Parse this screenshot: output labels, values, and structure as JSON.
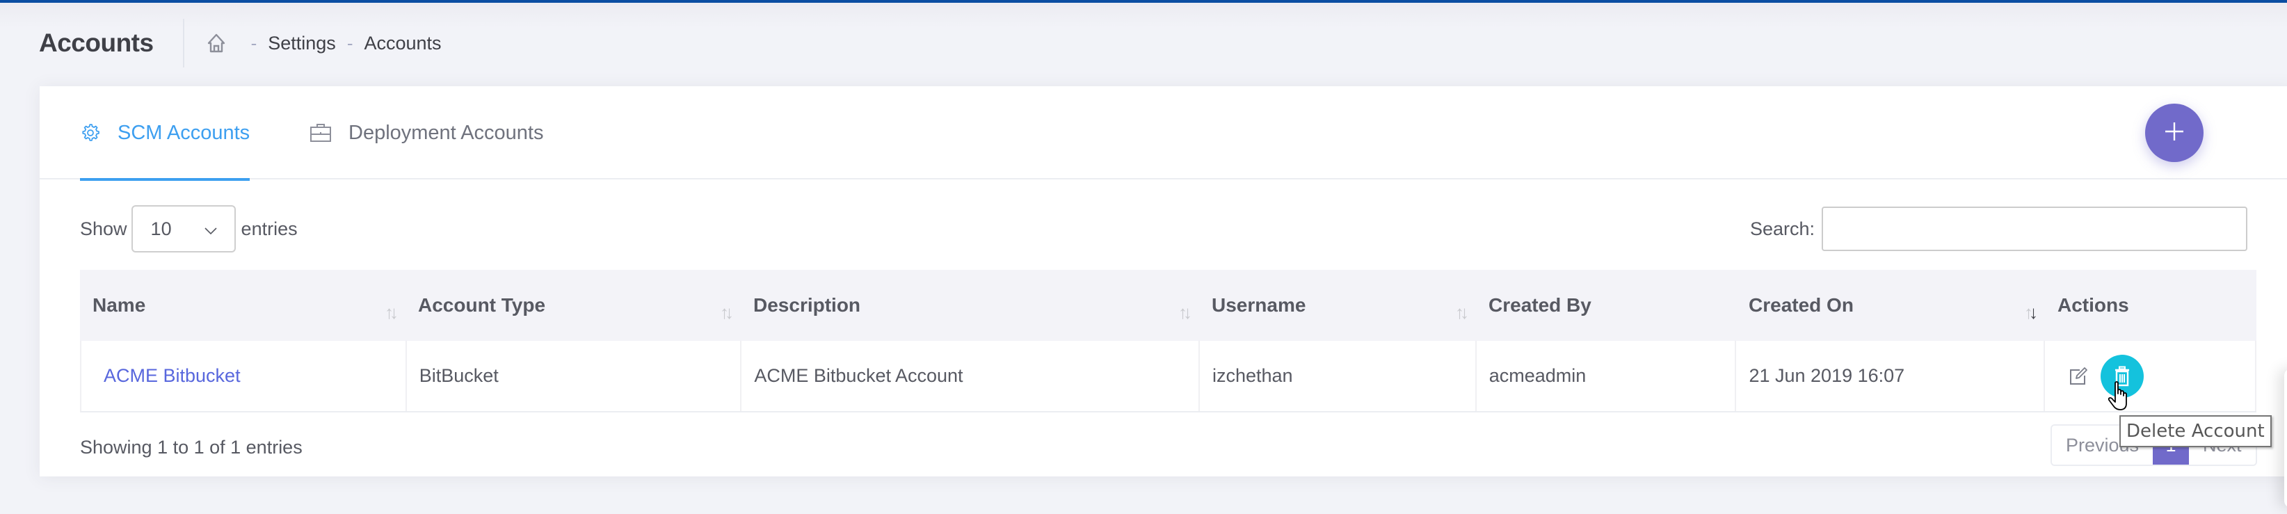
{
  "header": {
    "title": "Accounts",
    "breadcrumb": [
      {
        "label": "home",
        "icon": "home-icon"
      },
      {
        "label": "Settings"
      },
      {
        "label": "Accounts"
      }
    ],
    "separator": "-"
  },
  "tabs": [
    {
      "label": "SCM Accounts",
      "icon": "gear-icon",
      "active": true
    },
    {
      "label": "Deployment Accounts",
      "icon": "briefcase-icon",
      "active": false
    }
  ],
  "add_button": {
    "icon": "plus-icon",
    "label": "+"
  },
  "length_control": {
    "prefix": "Show",
    "value": "10",
    "suffix": "entries"
  },
  "search": {
    "label": "Search:",
    "value": "",
    "placeholder": ""
  },
  "table": {
    "columns": [
      {
        "label": "Name",
        "sortable": true
      },
      {
        "label": "Account Type",
        "sortable": true
      },
      {
        "label": "Description",
        "sortable": true
      },
      {
        "label": "Username",
        "sortable": true
      },
      {
        "label": "Created By",
        "sortable": false
      },
      {
        "label": "Created On",
        "sortable": true,
        "sort": "desc"
      },
      {
        "label": "Actions",
        "sortable": false
      }
    ],
    "rows": [
      {
        "name": "ACME Bitbucket",
        "account_type": "BitBucket",
        "description": "ACME Bitbucket Account",
        "username": "izchethan",
        "created_by": "acmeadmin",
        "created_on": "21 Jun 2019 16:07",
        "actions": [
          "edit-icon",
          "trash-icon"
        ]
      }
    ]
  },
  "footer": {
    "info": "Showing 1 to 1 of 1 entries",
    "pagination": {
      "previous": "Previous",
      "current": "1",
      "next": "Next"
    }
  },
  "tooltip": "Delete Account",
  "colors": {
    "accent": "#716aca",
    "tab_active": "#3d9ff0",
    "link": "#5867dd",
    "delete_button": "#14c2dd",
    "topbar": "#0b4ea2"
  }
}
